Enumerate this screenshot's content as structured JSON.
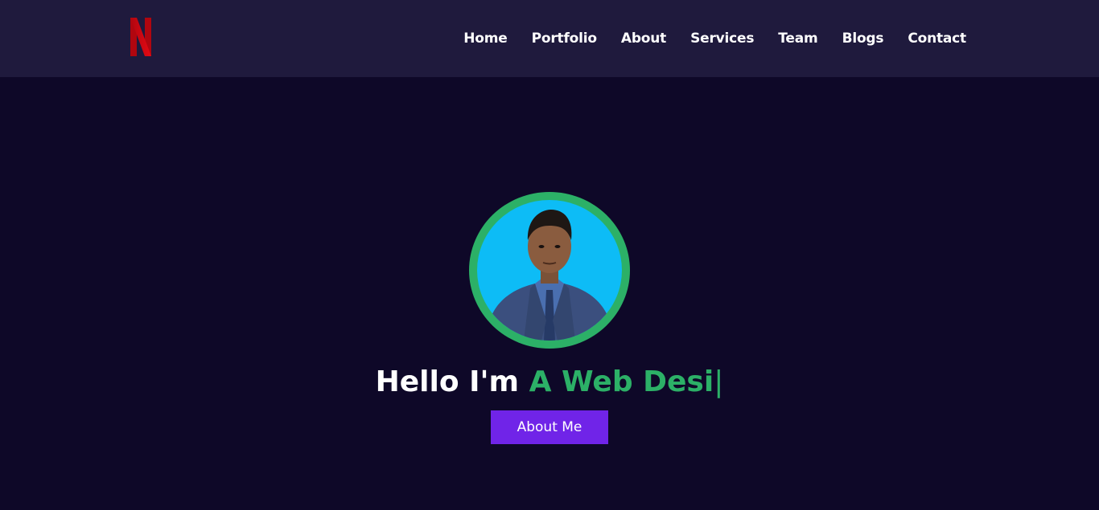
{
  "brand": {
    "logo_icon": "netflix-n-logo",
    "logo_color": "#e50914"
  },
  "nav": {
    "items": [
      {
        "label": "Home"
      },
      {
        "label": "Portfolio"
      },
      {
        "label": "About"
      },
      {
        "label": "Services"
      },
      {
        "label": "Team"
      },
      {
        "label": "Blogs"
      },
      {
        "label": "Contact"
      }
    ]
  },
  "hero": {
    "greeting": "Hello I'm ",
    "typed_text": "A Web Desi",
    "cursor": "|",
    "button_label": "About Me",
    "avatar_icon": "profile-photo",
    "colors": {
      "accent_green": "#2cb067",
      "button_purple": "#7024e8",
      "avatar_bg": "#0dbcf6",
      "page_bg": "#0e0828",
      "navbar_bg": "#1f1a3d"
    }
  }
}
